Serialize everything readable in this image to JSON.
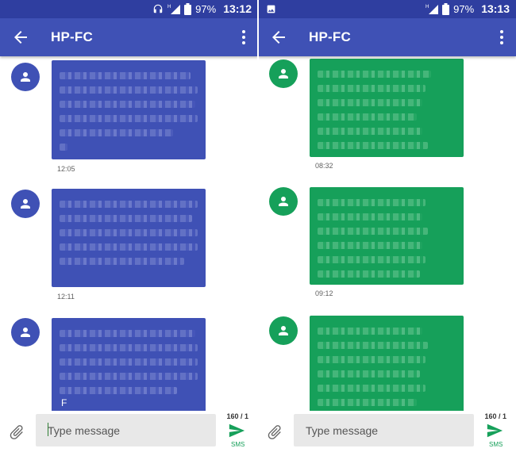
{
  "colors": {
    "status_bar": "#2f3ea0",
    "app_bar": "#3f51b5",
    "sent_bubble": "#3f51b5",
    "received_bubble": "#16a05a",
    "send_green": "#16a05a"
  },
  "left": {
    "status": {
      "battery": "97%",
      "time": "13:12",
      "network": "H"
    },
    "header": {
      "title": "HP-FC"
    },
    "messages": [
      {
        "time": "12:05",
        "trailing_char": ""
      },
      {
        "time": "12:11",
        "trailing_char": ""
      },
      {
        "time": "",
        "trailing_char": "F"
      }
    ],
    "composer": {
      "placeholder": "Type message",
      "counter": "160 / 1",
      "send_label": "SMS"
    }
  },
  "right": {
    "status": {
      "battery": "97%",
      "time": "13:13",
      "network": "H"
    },
    "header": {
      "title": "HP-FC"
    },
    "messages": [
      {
        "time": "08:32"
      },
      {
        "time": "09:12"
      },
      {
        "time": ""
      }
    ],
    "composer": {
      "placeholder": "Type message",
      "counter": "160 / 1",
      "send_label": "SMS"
    }
  }
}
